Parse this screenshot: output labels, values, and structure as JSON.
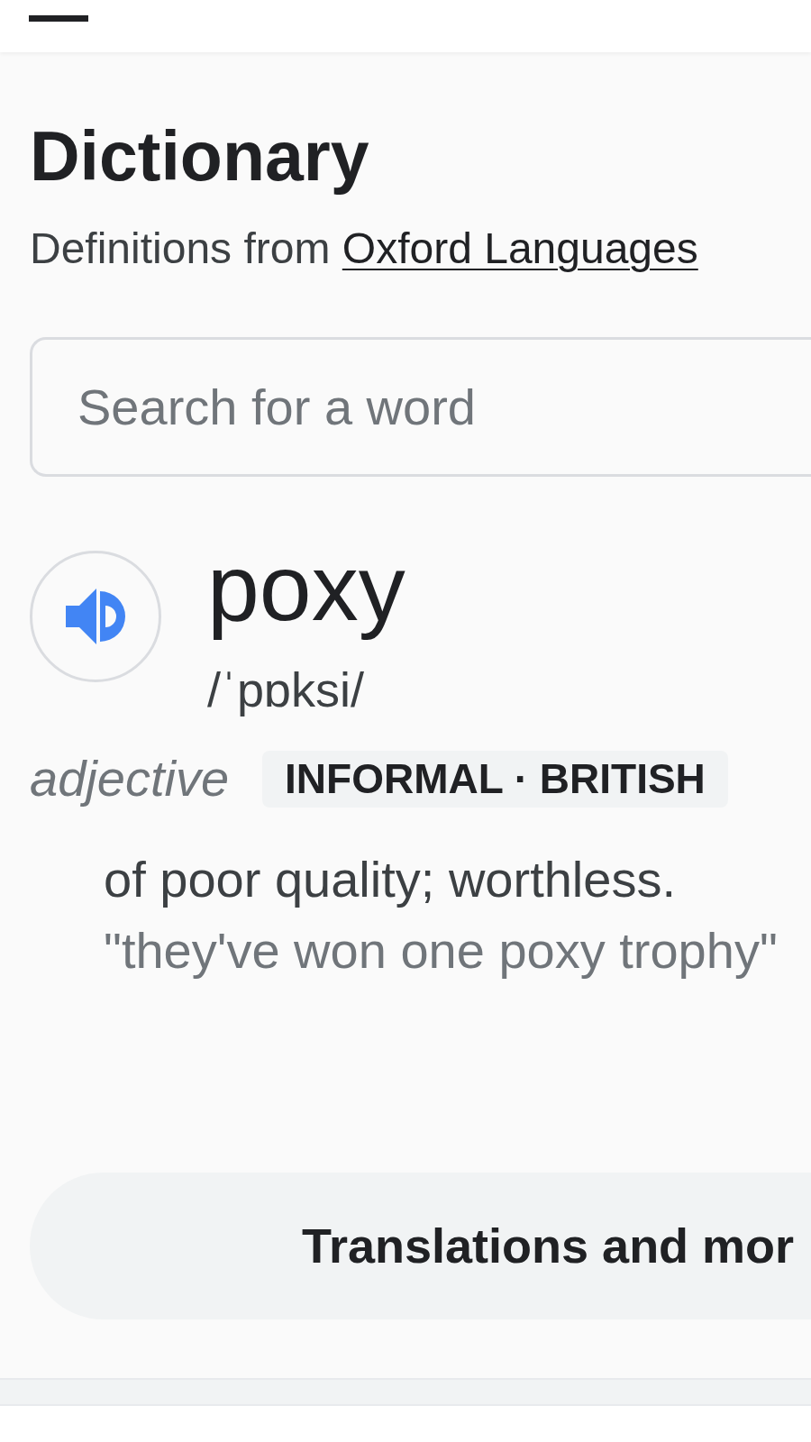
{
  "header": {
    "title": "Dictionary",
    "source_prefix": "Definitions from",
    "source_link": "Oxford Languages"
  },
  "search": {
    "placeholder": "Search for a word"
  },
  "entry": {
    "word": "poxy",
    "pronunciation": "/ˈpɒksi/",
    "part_of_speech": "adjective",
    "usage_label": "INFORMAL · BRITISH",
    "senses": [
      {
        "definition": "of poor quality; worthless.",
        "example": "\"they've won one poxy trophy\""
      }
    ]
  },
  "more_button": {
    "label": "Translations and mor"
  }
}
